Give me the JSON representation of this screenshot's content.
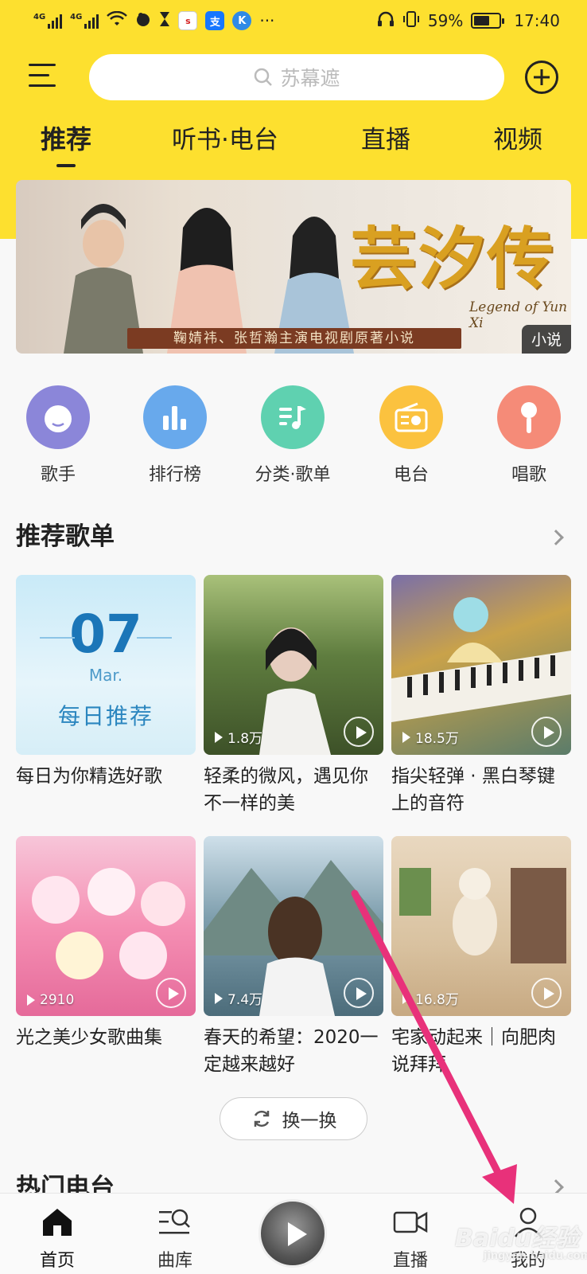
{
  "status_bar": {
    "network1": "4G",
    "network2": "4G",
    "battery": "59%",
    "time": "17:40",
    "overflow": "···"
  },
  "header": {
    "search_placeholder": "苏幕遮",
    "tabs": [
      {
        "label": "推荐",
        "active": true
      },
      {
        "label": "听书·电台",
        "active": false
      },
      {
        "label": "直播",
        "active": false
      },
      {
        "label": "视频",
        "active": false
      }
    ],
    "brand_color": "#fde02f"
  },
  "banner": {
    "title": "芸汐传",
    "title_en": "Legend of Yun Xi",
    "subtitle": "鞠婧祎、张哲瀚主演电视剧原著小说",
    "tag": "小说"
  },
  "quick_entries": [
    {
      "label": "歌手",
      "icon": "singer-face-icon",
      "color": "#8b86d9"
    },
    {
      "label": "排行榜",
      "icon": "bar-chart-icon",
      "color": "#68a9ec"
    },
    {
      "label": "分类·歌单",
      "icon": "music-list-icon",
      "color": "#5fd1b0"
    },
    {
      "label": "电台",
      "icon": "radio-icon",
      "color": "#fbc23f"
    },
    {
      "label": "唱歌",
      "icon": "microphone-icon",
      "color": "#f58b78"
    }
  ],
  "playlist_section": {
    "title": "推荐歌单",
    "daily": {
      "day": "07",
      "month": "Mar.",
      "label": "每日推荐"
    },
    "cards": [
      {
        "title": "每日为你精选好歌",
        "plays": ""
      },
      {
        "title": "轻柔的微风，遇见你不一样的美",
        "plays": "1.8万"
      },
      {
        "title": "指尖轻弹 · 黑白琴键上的音符",
        "plays": "18.5万"
      },
      {
        "title": "光之美少女歌曲集",
        "plays": "2910"
      },
      {
        "title": "春天的希望：2020一定越来越好",
        "plays": "7.4万"
      },
      {
        "title": "宅家动起来｜向肥肉说拜拜",
        "plays": "16.8万"
      }
    ],
    "refresh_label": "换一换"
  },
  "radio_section": {
    "title": "热门电台"
  },
  "bottom_nav": [
    {
      "label": "首页",
      "active": true
    },
    {
      "label": "曲库",
      "active": false
    },
    {
      "label": "直播",
      "active": false
    },
    {
      "label": "我的",
      "active": false
    }
  ],
  "watermark": {
    "text": "Baidu经验",
    "sub": "jingyan.baidu.com"
  }
}
